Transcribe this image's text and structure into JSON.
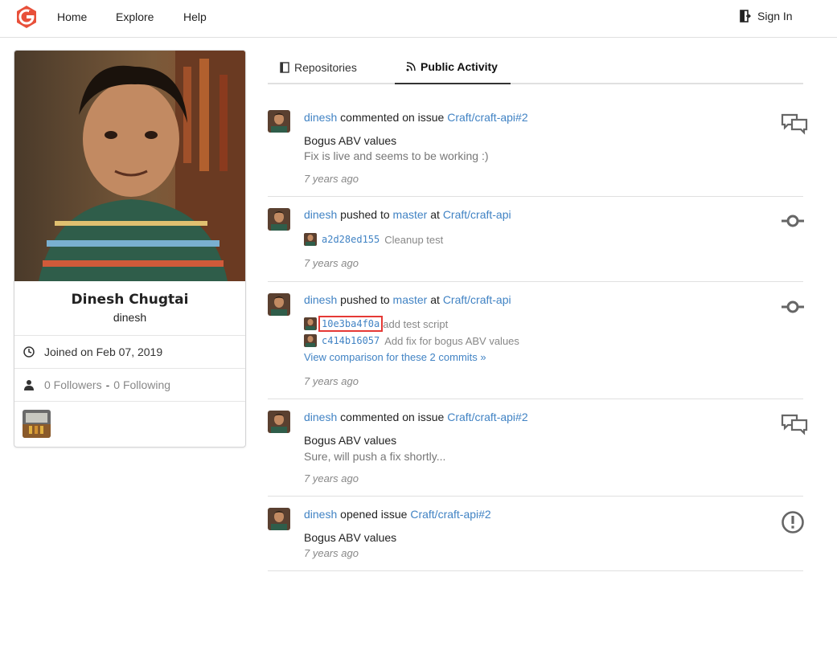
{
  "nav": {
    "home": "Home",
    "explore": "Explore",
    "help": "Help",
    "sign_in": "Sign In"
  },
  "profile": {
    "full_name": "Dinesh Chugtai",
    "username": "dinesh",
    "joined": "Joined on Feb 07, 2019",
    "followers": "0 Followers",
    "separator": "-",
    "following": "0 Following"
  },
  "tabs": {
    "repositories": "Repositories",
    "public_activity": "Public Activity"
  },
  "feed": [
    {
      "user": "dinesh",
      "action": "commented on issue",
      "target": "Craft/craft-api#2",
      "title": "Bogus ABV values",
      "comment": "Fix is live and seems to be working :)",
      "time": "7 years ago",
      "icon": "comment-discussion-icon"
    },
    {
      "user": "dinesh",
      "action": "pushed to",
      "branch": "master",
      "at": "at",
      "repo": "Craft/craft-api",
      "commits": [
        {
          "sha": "a2d28ed155",
          "message": "Cleanup test"
        }
      ],
      "time": "7 years ago",
      "icon": "git-commit-icon"
    },
    {
      "user": "dinesh",
      "action": "pushed to",
      "branch": "master",
      "at": "at",
      "repo": "Craft/craft-api",
      "commits": [
        {
          "sha": "10e3ba4f0a",
          "message": "add test script"
        },
        {
          "sha": "c414b16057",
          "message": "Add fix for bogus ABV values"
        }
      ],
      "compare": "View comparison for these 2 commits »",
      "time": "7 years ago",
      "icon": "git-commit-icon"
    },
    {
      "user": "dinesh",
      "action": "commented on issue",
      "target": "Craft/craft-api#2",
      "title": "Bogus ABV values",
      "comment": "Sure, will push a fix shortly...",
      "time": "7 years ago",
      "icon": "comment-discussion-icon"
    },
    {
      "user": "dinesh",
      "action": "opened issue",
      "target": "Craft/craft-api#2",
      "title": "Bogus ABV values",
      "time": "7 years ago",
      "icon": "issue-opened-icon"
    }
  ],
  "colors": {
    "link": "#4183c4",
    "logo": "#e8503a",
    "highlight": "#e53935"
  }
}
